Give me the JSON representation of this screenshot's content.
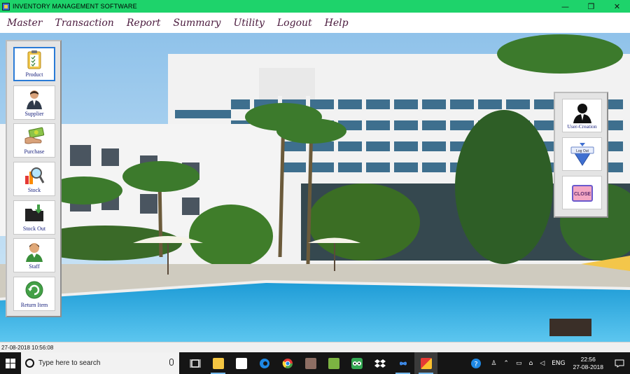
{
  "window": {
    "title": "INVENTORY MANAGEMENT SOFTWARE",
    "controls": {
      "minimize": "—",
      "maximize": "❐",
      "close": "✕"
    }
  },
  "menu": [
    "Master",
    "Transaction",
    "Report",
    "Summary",
    "Utility",
    "Logout",
    "Help"
  ],
  "left_nav": [
    {
      "label": "Product",
      "icon": "clipboard-icon",
      "active": true
    },
    {
      "label": "Supplier",
      "icon": "businessman-icon"
    },
    {
      "label": "Purchase",
      "icon": "money-hand-icon"
    },
    {
      "label": "Stock",
      "icon": "magnifier-chart-icon"
    },
    {
      "label": "Stock Out",
      "icon": "folder-arrow-icon"
    },
    {
      "label": "Staff",
      "icon": "staff-person-icon"
    },
    {
      "label": "Return Item",
      "icon": "green-refresh-icon"
    }
  ],
  "right_nav": [
    {
      "label": "User-Creation",
      "icon": "user-silhouette-icon"
    },
    {
      "label": "Log Out",
      "icon": "logout-triangle-icon"
    },
    {
      "label": "CLOSE",
      "icon": "close-box-icon"
    }
  ],
  "status": {
    "datetime": "27-08-2018   10:56:08"
  },
  "taskbar": {
    "search_placeholder": "Type here to search",
    "language": "ENG",
    "time": "22:56",
    "date": "27-08-2018"
  },
  "colors": {
    "titlebar": "#1ed36b",
    "menu_text": "#4a1a3d",
    "label_text": "#1a237e",
    "taskbar": "#151515"
  }
}
